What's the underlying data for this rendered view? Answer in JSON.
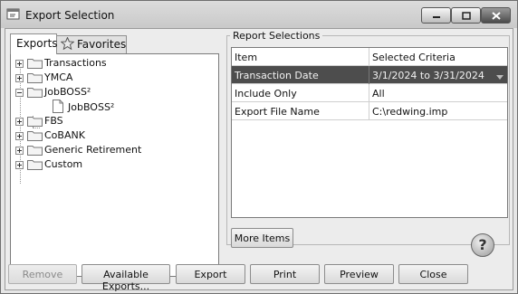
{
  "window": {
    "title": "Export Selection",
    "controls": [
      "minimize",
      "maximize",
      "close"
    ]
  },
  "tabs": [
    {
      "label": "Exports",
      "active": true
    },
    {
      "label": "Favorites",
      "icon": "star-icon",
      "active": false
    }
  ],
  "tree": {
    "items": [
      {
        "label": "Transactions",
        "state": "collapsed",
        "icon": "folder-icon"
      },
      {
        "label": "YMCA",
        "state": "collapsed",
        "icon": "folder-icon"
      },
      {
        "label": "JobBOSS²",
        "state": "expanded",
        "icon": "folder-icon",
        "children": [
          {
            "label": "JobBOSS²",
            "icon": "document-icon"
          }
        ]
      },
      {
        "label": "FBS",
        "state": "collapsed",
        "icon": "folder-icon"
      },
      {
        "label": "CoBANK",
        "state": "collapsed",
        "icon": "folder-icon"
      },
      {
        "label": "Generic Retirement",
        "state": "collapsed",
        "icon": "folder-icon"
      },
      {
        "label": "Custom",
        "state": "collapsed",
        "icon": "folder-icon"
      }
    ]
  },
  "report_selections": {
    "group_label": "Report Selections",
    "columns": [
      "Item",
      "Selected Criteria"
    ],
    "rows": [
      {
        "item": "Transaction Date",
        "criteria": "3/1/2024 to 3/31/2024",
        "selected": true
      },
      {
        "item": "Include Only",
        "criteria": "All",
        "selected": false
      },
      {
        "item": "Export File Name",
        "criteria": "C:\\redwing.imp",
        "selected": false
      }
    ],
    "more_items_label": "More Items"
  },
  "buttons": {
    "remove": "Remove",
    "available_exports": "Available Exports...",
    "export": "Export",
    "print": "Print",
    "preview": "Preview",
    "close": "Close",
    "help": "?"
  },
  "colors": {
    "selected_row": "#4d4d4d",
    "window_bg": "#ececec"
  }
}
